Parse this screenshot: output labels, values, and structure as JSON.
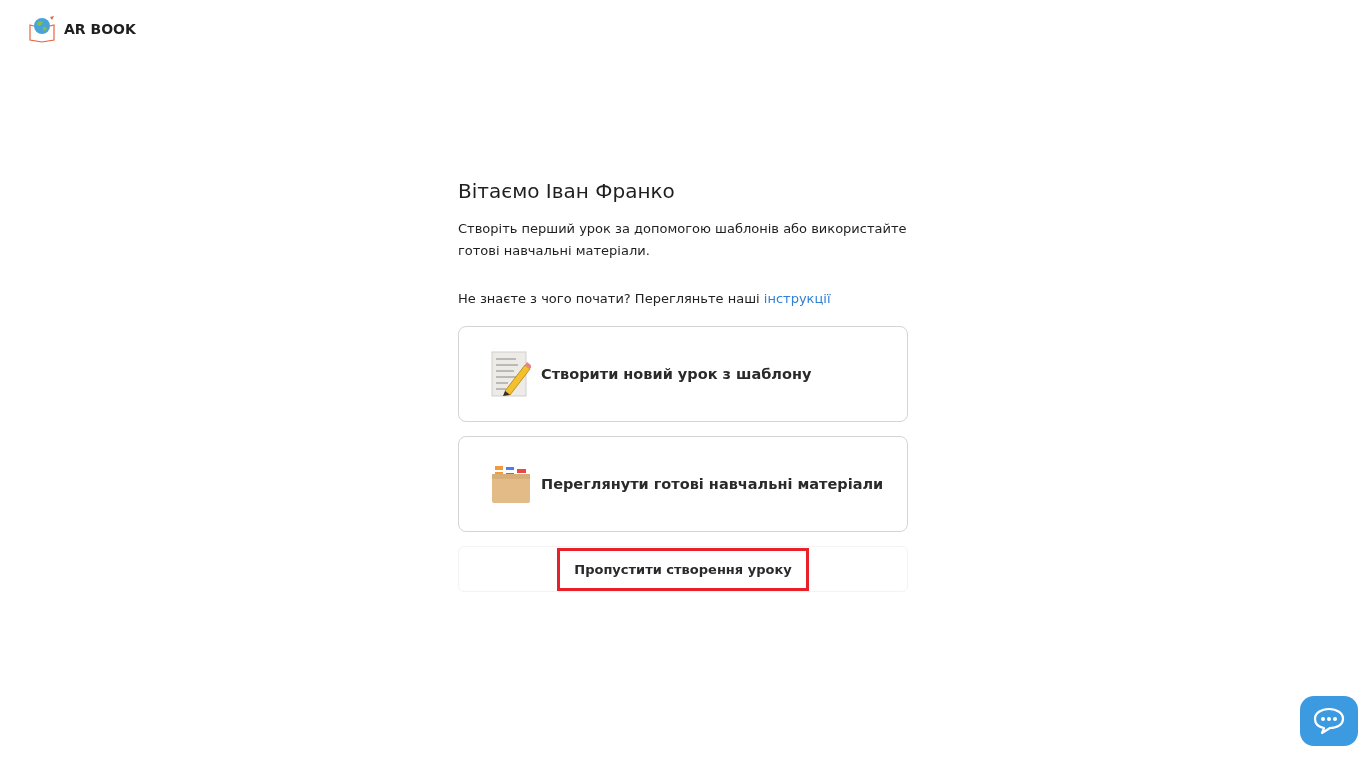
{
  "header": {
    "logo_text": "AR BOOK"
  },
  "welcome": {
    "title": "Вітаємо Іван Франко",
    "description": "Створіть перший урок за допомогою шаблонів або використайте готові навчальні матеріали.",
    "help_text": "Не знаєте з чого почати? Перегляньте наші",
    "help_link": "інструкції"
  },
  "options": [
    {
      "kind": "template",
      "label": "Створити новий урок з шаблону"
    },
    {
      "kind": "materials",
      "label": "Переглянути готові навчальні матеріали"
    }
  ],
  "skip_button": {
    "label": "Пропустити створення уроку",
    "highlighted": true
  },
  "chat_button": {
    "kind": "chat"
  }
}
